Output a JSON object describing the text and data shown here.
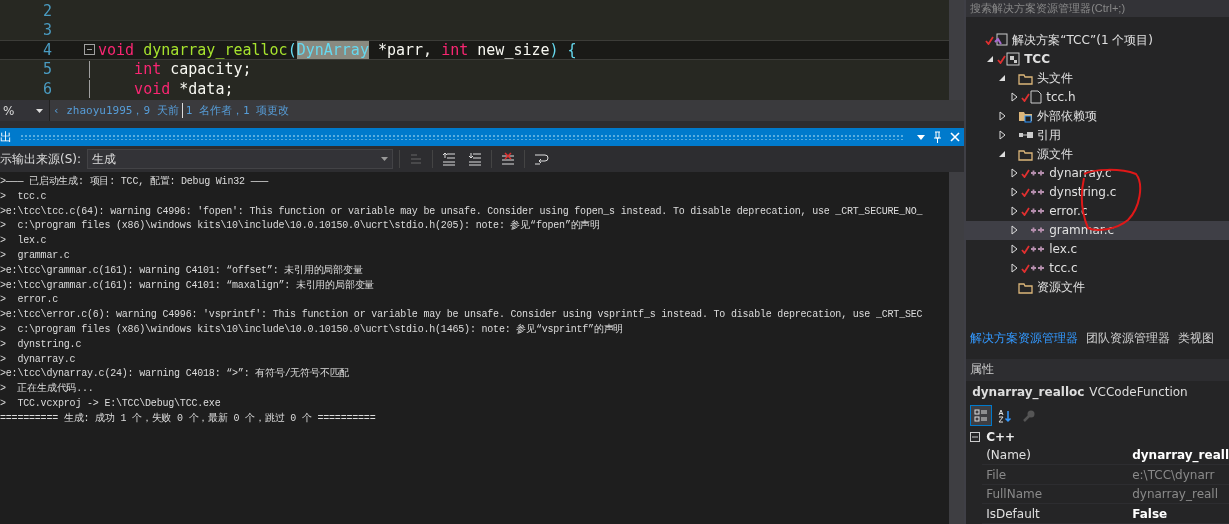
{
  "editor": {
    "lines": [
      {
        "number": "2",
        "collapsible": false,
        "current": false
      },
      {
        "number": "3",
        "collapsible": false,
        "current": false
      },
      {
        "number": "4",
        "collapsible": true,
        "current": true,
        "tokens": [
          {
            "text": "void ",
            "kind": "keyword"
          },
          {
            "text": "dynarray_realloc",
            "kind": "function"
          },
          {
            "text": "(",
            "kind": "punct"
          },
          {
            "text": "DynArray",
            "kind": "reference"
          },
          {
            "text": " *parr, ",
            "kind": "plain"
          },
          {
            "text": "int",
            "kind": "keyword"
          },
          {
            "text": " new_size",
            "kind": "plain"
          },
          {
            "text": ") {",
            "kind": "punct"
          }
        ]
      },
      {
        "number": "5",
        "collapsible": false,
        "current": false,
        "tokens": [
          {
            "text": "    int",
            "kind": "keyword"
          },
          {
            "text": " capacity;",
            "kind": "plain"
          }
        ]
      },
      {
        "number": "6",
        "collapsible": false,
        "current": false,
        "tokens": [
          {
            "text": "    void",
            "kind": "keyword"
          },
          {
            "text": " *data;",
            "kind": "plain"
          }
        ]
      }
    ]
  },
  "codelens": {
    "zoom": "%",
    "author": "‹ zhaoyu1995，9 天前",
    "changes": "1 名作者，1 项更改"
  },
  "output": {
    "title": "出",
    "source_label": "示输出来源(S):",
    "source": "生成",
    "lines": [
      ">——— 已启动生成: 项目: TCC, 配置: Debug Win32 ———",
      ">  tcc.c",
      ">e:\\tcc\\tcc.c(64): warning C4996: 'fopen': This function or variable may be unsafe. Consider using fopen_s instead. To disable deprecation, use _CRT_SECURE_NO_",
      ">  c:\\program files (x86)\\windows kits\\10\\include\\10.0.10150.0\\ucrt\\stdio.h(205): note: 参见“fopen”的声明",
      ">  lex.c",
      ">  grammar.c",
      ">e:\\tcc\\grammar.c(161): warning C4101: “offset”: 未引用的局部变量",
      ">e:\\tcc\\grammar.c(161): warning C4101: “maxalign”: 未引用的局部变量",
      ">  error.c",
      ">e:\\tcc\\error.c(6): warning C4996: 'vsprintf': This function or variable may be unsafe. Consider using vsprintf_s instead. To disable deprecation, use _CRT_SEC",
      ">  c:\\program files (x86)\\windows kits\\10\\include\\10.0.10150.0\\ucrt\\stdio.h(1465): note: 参见“vsprintf”的声明",
      ">  dynstring.c",
      ">  dynarray.c",
      ">e:\\tcc\\dynarray.c(24): warning C4018: “>”: 有符号/无符号不匹配",
      ">  正在生成代码...",
      ">  TCC.vcxproj -> E:\\TCC\\Debug\\TCC.exe",
      "========== 生成: 成功 1 个，失败 0 个，最新 0 个，跳过 0 个 =========="
    ]
  },
  "solution_explorer": {
    "search": {
      "placeholder": "搜索解决方案资源管理器(Ctrl+;)"
    },
    "tree": [
      {
        "label": "解决方案“TCC”(1 个项目)",
        "kind": "solution",
        "checked": true,
        "selected": false,
        "children": [
          {
            "label": "TCC",
            "kind": "project",
            "expanded": true,
            "checked": true,
            "selected": false,
            "children": [
              {
                "label": "头文件",
                "kind": "folder",
                "expanded": true,
                "checked": false,
                "selected": false,
                "children": [
                  {
                    "label": "tcc.h",
                    "kind": "header",
                    "expanded": false,
                    "checked": true,
                    "selected": false
                  }
                ]
              },
              {
                "label": "外部依赖项",
                "kind": "dependencies",
                "expanded": false,
                "checked": false,
                "selected": false
              },
              {
                "label": "引用",
                "kind": "references",
                "expanded": false,
                "checked": false,
                "selected": false
              },
              {
                "label": "源文件",
                "kind": "folder",
                "expanded": true,
                "checked": false,
                "selected": false,
                "children": [
                  {
                    "label": "dynarray.c",
                    "kind": "source",
                    "expanded": false,
                    "checked": true,
                    "selected": false
                  },
                  {
                    "label": "dynstring.c",
                    "kind": "source",
                    "expanded": false,
                    "checked": true,
                    "selected": false
                  },
                  {
                    "label": "error.c",
                    "kind": "source",
                    "expanded": false,
                    "checked": true,
                    "selected": false
                  },
                  {
                    "label": "grammar.c",
                    "kind": "source",
                    "expanded": false,
                    "checked": false,
                    "selected": true
                  },
                  {
                    "label": "lex.c",
                    "kind": "source",
                    "expanded": false,
                    "checked": true,
                    "selected": false
                  },
                  {
                    "label": "tcc.c",
                    "kind": "source",
                    "expanded": false,
                    "checked": true,
                    "selected": false
                  }
                ]
              },
              {
                "label": "资源文件",
                "kind": "folder",
                "checked": false,
                "selected": false
              }
            ]
          }
        ]
      }
    ]
  },
  "tabs": [
    {
      "label": "解决方案资源管理器",
      "selected": true
    },
    {
      "label": "团队资源管理器",
      "selected": false
    },
    {
      "label": "类视图",
      "selected": false
    }
  ],
  "properties": {
    "title": "属性",
    "object_name": "dynarray_realloc",
    "object_type": "VCCodeFunction",
    "view_buttons": [
      {
        "kind": "categorized",
        "selected": true
      },
      {
        "kind": "alphabetical",
        "selected": false
      },
      {
        "kind": "pages",
        "selected": false
      }
    ],
    "category": "C++",
    "rows": [
      {
        "name": "(Name)",
        "value": "dynarray_reall",
        "disabled": false
      },
      {
        "name": "File",
        "value": "e:\\TCC\\dynarr",
        "disabled": true
      },
      {
        "name": "FullName",
        "value": "dynarray_reall",
        "disabled": true
      },
      {
        "name": "IsDefault",
        "value": "False",
        "disabled": false
      }
    ]
  }
}
